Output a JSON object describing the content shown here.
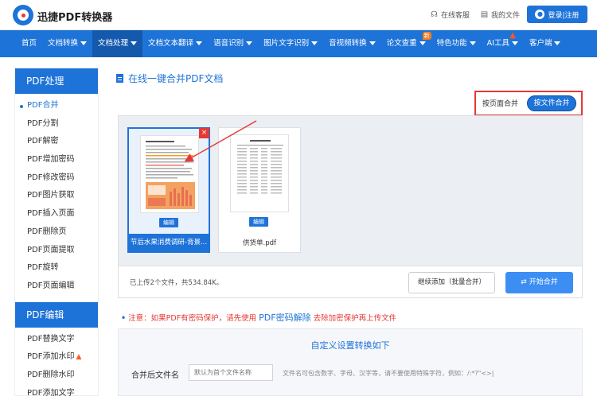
{
  "header": {
    "brand": "迅捷PDF转换器",
    "service_link": "在线客服",
    "files_link": "我的文件",
    "login_label": "登录|注册"
  },
  "nav": {
    "items": [
      {
        "label": "首页",
        "dropdown": false
      },
      {
        "label": "文档转换",
        "dropdown": true
      },
      {
        "label": "文档处理",
        "dropdown": true,
        "active": true
      },
      {
        "label": "文档文本翻译",
        "dropdown": true
      },
      {
        "label": "语音识别",
        "dropdown": true
      },
      {
        "label": "图片文字识别",
        "dropdown": true
      },
      {
        "label": "音视频转换",
        "dropdown": true
      },
      {
        "label": "论文查重",
        "dropdown": true,
        "badge": "新"
      },
      {
        "label": "特色功能",
        "dropdown": true
      },
      {
        "label": "AI工具",
        "dropdown": true,
        "fire": true
      },
      {
        "label": "客户端",
        "dropdown": true
      }
    ]
  },
  "sidebar": {
    "section1_title": "PDF处理",
    "section1_items": [
      "PDF合并",
      "PDF分割",
      "PDF解密",
      "PDF增加密码",
      "PDF修改密码",
      "PDF图片获取",
      "PDF插入页面",
      "PDF删除页",
      "PDF页面提取",
      "PDF旋转",
      "PDF页面编辑"
    ],
    "section2_title": "PDF编辑",
    "section2_items": [
      "PDF替换文字",
      "PDF添加水印",
      "PDF删除水印",
      "PDF添加文字"
    ]
  },
  "main": {
    "title": "在线一键合并PDF文档",
    "mode_page": "按页面合并",
    "mode_file": "按文件合并",
    "files": [
      {
        "name": "节后水果消费调研-背景...",
        "edit": "编辑",
        "selected": true
      },
      {
        "name": "供货单.pdf",
        "edit": "编辑",
        "selected": false
      }
    ],
    "status": "已上传2个文件，共534.84K。",
    "add_button": "继续添加（批量合并）",
    "start_button": "开始合并",
    "notice_prefix": "注意：如果PDF有密码保护，请先使用",
    "notice_link": "PDF密码解除",
    "notice_suffix": "去除加密保护再上传文件",
    "settings_title": "自定义设置转换如下",
    "settings_label": "合并后文件名",
    "settings_placeholder": "默认为首个文件名称",
    "settings_hint": "文件名可包含数字、字母、汉字等，请不要使用特殊字符，例如：/:*?\"<>|"
  },
  "colors": {
    "primary": "#1e73d8",
    "highlight": "#e53935"
  }
}
